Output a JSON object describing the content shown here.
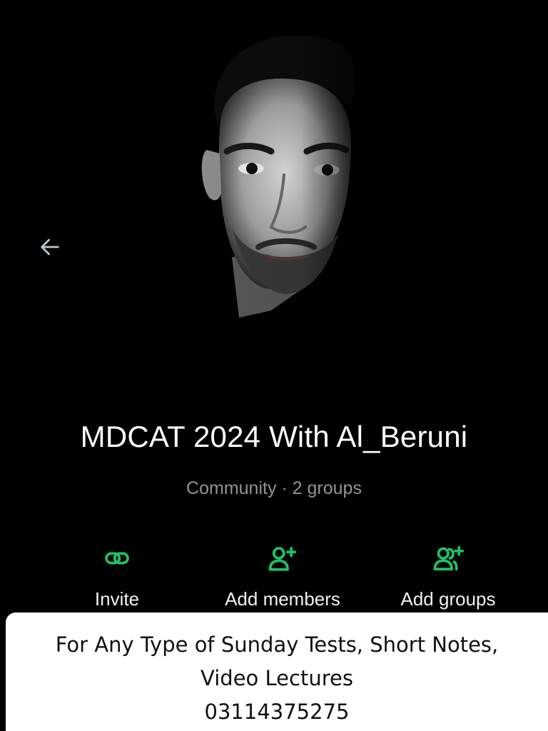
{
  "header": {
    "back_icon": "arrow-left-icon"
  },
  "community": {
    "name": "MDCAT 2024 With Al_Beruni",
    "meta": "Community · 2 groups"
  },
  "actions": [
    {
      "label": "Invite",
      "icon": "link-icon"
    },
    {
      "label": "Add members",
      "icon": "person-add-icon"
    },
    {
      "label": "Add groups",
      "icon": "group-add-icon"
    }
  ],
  "banner": {
    "line1": "For Any Type of Sunday Tests, Short Notes,",
    "line2": "Video Lectures",
    "line3": "03114375275"
  },
  "colors": {
    "background": "#000000",
    "accent": "#21c063",
    "muted_text": "#8d9599",
    "banner_bg": "#ffffff"
  }
}
